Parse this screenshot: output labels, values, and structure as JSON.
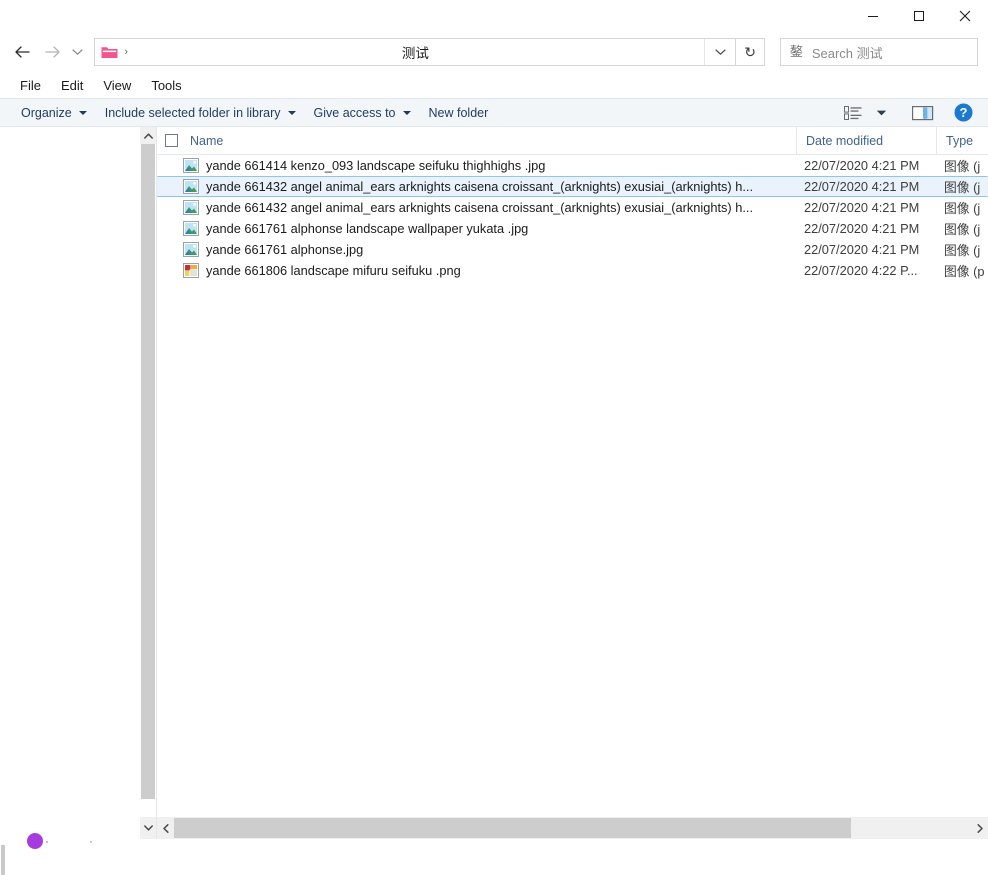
{
  "window": {
    "controls": {
      "minimize": "minimize-button",
      "maximize": "maximize-button",
      "close": "close-button"
    }
  },
  "navbar": {
    "back_icon": "back-arrow-icon",
    "forward_icon": "forward-arrow-icon",
    "recent_icon": "recent-locations-chevron-icon",
    "breadcrumb_folder_icon": "folder-icon",
    "breadcrumb_separator": "›",
    "address_title": "测试",
    "address_dropdown_icon": "chevron-down-icon",
    "refresh_icon": "refresh-icon",
    "refresh_glyph": "↻"
  },
  "search": {
    "icon_glyph": "鏊",
    "placeholder": "Search 测试",
    "value": ""
  },
  "menubar": {
    "items": [
      {
        "label": "File"
      },
      {
        "label": "Edit"
      },
      {
        "label": "View"
      },
      {
        "label": "Tools"
      }
    ]
  },
  "toolbar": {
    "commands": [
      {
        "label": "Organize",
        "has_caret": true
      },
      {
        "label": "Include selected folder in library",
        "has_caret": true
      },
      {
        "label": "Give access to",
        "has_caret": true
      },
      {
        "label": "New folder",
        "has_caret": false
      }
    ],
    "view_icon": "list-view-icon",
    "view_caret": "chevron-down-icon",
    "preview_pane_icon": "preview-pane-icon",
    "help_icon": "help-icon",
    "help_glyph": "?"
  },
  "columns": {
    "name": "Name",
    "date_modified": "Date modified",
    "type": "Type",
    "sort_indicator": "⌃"
  },
  "files": [
    {
      "name": "yande 661414 kenzo_093 landscape seifuku thighhighs .jpg",
      "date": "22/07/2020 4:21 PM",
      "type": "图像 (j",
      "icon": "jpg-image-icon",
      "selected": false
    },
    {
      "name": "yande 661432 angel animal_ears arknights caisena croissant_(arknights) exusiai_(arknights) h...",
      "date": "22/07/2020 4:21 PM",
      "type": "图像 (j",
      "icon": "jpg-image-icon",
      "selected": true
    },
    {
      "name": "yande 661432 angel animal_ears arknights caisena croissant_(arknights) exusiai_(arknights) h...",
      "date": "22/07/2020 4:21 PM",
      "type": "图像 (j",
      "icon": "jpg-image-icon",
      "selected": false
    },
    {
      "name": "yande 661761 alphonse landscape wallpaper yukata .jpg",
      "date": "22/07/2020 4:21 PM",
      "type": "图像 (j",
      "icon": "jpg-image-icon",
      "selected": false
    },
    {
      "name": "yande 661761 alphonse.jpg",
      "date": "22/07/2020 4:21 PM",
      "type": "图像 (j",
      "icon": "jpg-image-icon",
      "selected": false
    },
    {
      "name": "yande 661806 landscape mifuru seifuku .png",
      "date": "22/07/2020 4:22 P...",
      "type": "图像 (p",
      "icon": "png-image-icon",
      "selected": false
    }
  ],
  "scrollbars": {
    "nav_up_glyph": "⌃",
    "nav_down_glyph": "⌄",
    "h_left_glyph": "‹",
    "h_right_glyph": "›"
  },
  "colors": {
    "folder_accent": "#f4558e",
    "toolbar_bg": "#f3f6f9",
    "toolbar_text": "#1f3a5f",
    "header_text": "#41628c",
    "selection_bg": "#eaf3fb",
    "selection_border": "#8ec5e8",
    "help_blue": "#1b79d0",
    "scrollbar_thumb": "#cdcdcd"
  }
}
